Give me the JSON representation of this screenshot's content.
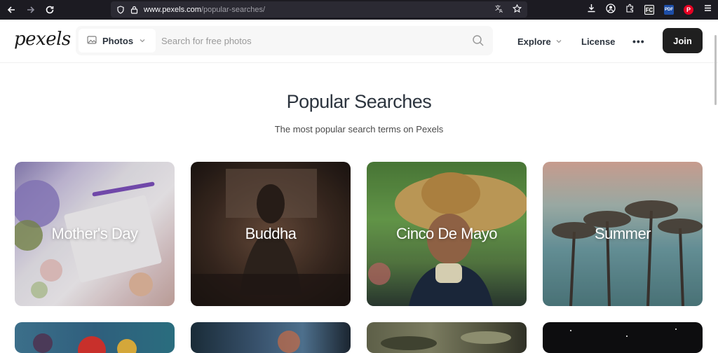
{
  "browser": {
    "url_host": "www.pexels.com",
    "url_path": "/popular-searches/",
    "ext_fc": "FC",
    "ext_pdf": "PDF"
  },
  "header": {
    "logo": "pexels",
    "search_type": "Photos",
    "search_placeholder": "Search for free photos",
    "nav_explore": "Explore",
    "nav_license": "License",
    "nav_more": "•••",
    "join_label": "Join"
  },
  "main": {
    "title": "Popular Searches",
    "subtitle": "The most popular search terms on Pexels"
  },
  "cards": [
    {
      "label": "Mother's Day"
    },
    {
      "label": "Buddha"
    },
    {
      "label": "Cinco De Mayo"
    },
    {
      "label": "Summer"
    }
  ],
  "colors": {
    "join_bg": "#1f1f1f",
    "chrome_bg": "#1c1b22"
  }
}
